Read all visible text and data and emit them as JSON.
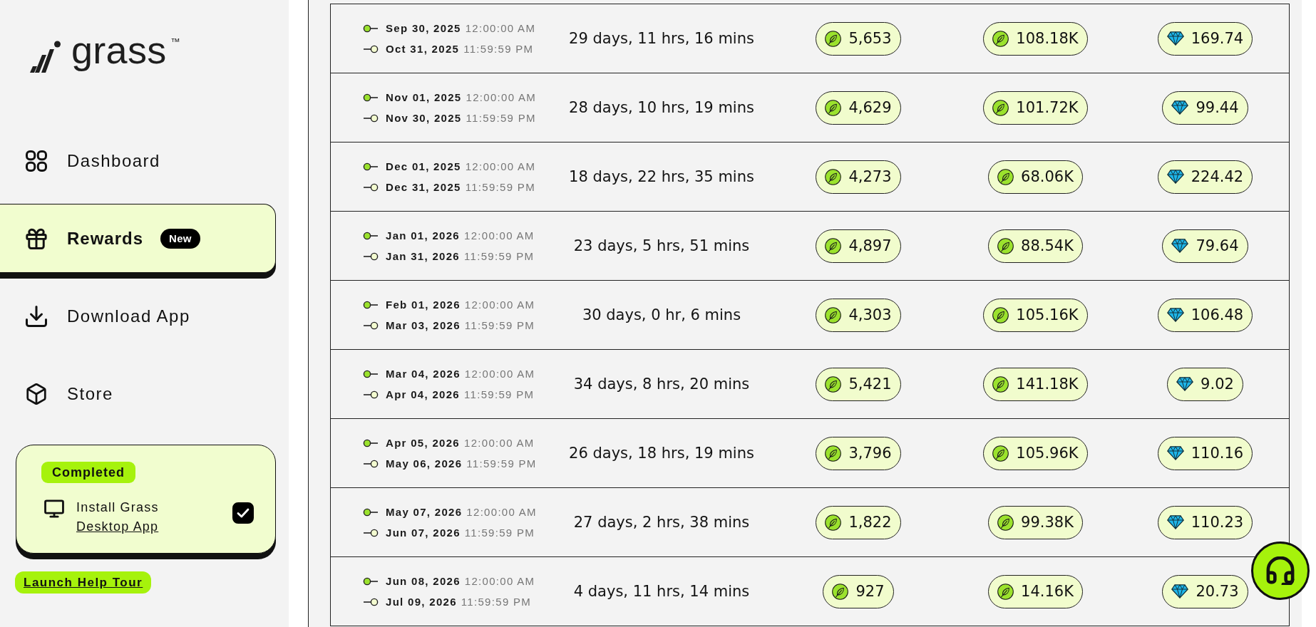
{
  "sidebar": {
    "logo": {
      "name": "grass",
      "trademark": "™"
    },
    "nav_items": [
      {
        "label": "Dashboard",
        "selected": false
      },
      {
        "label": "Rewards",
        "selected": true,
        "badge": "New"
      },
      {
        "label": "Download App",
        "selected": false
      },
      {
        "label": "Store",
        "selected": false
      }
    ],
    "task_card": {
      "status": "Completed",
      "text": "Install Grass",
      "link": "Desktop App",
      "checked": true
    },
    "help_tour": "Launch Help Tour"
  },
  "table": {
    "rows": [
      {
        "column_1": {
          "start": {
            "date": "Sep 30, 2025",
            "time": "12:00:00 AM"
          },
          "end": {
            "date": "Oct 31, 2025",
            "time": "11:59:59 PM"
          }
        },
        "column_2": "29 days, 11 hrs, 16 mins",
        "column_3": "5,653",
        "column_4": "108.18K",
        "column_5": "169.74"
      },
      {
        "column_1": {
          "start": {
            "date": "Nov 01, 2025",
            "time": "12:00:00 AM"
          },
          "end": {
            "date": "Nov 30, 2025",
            "time": "11:59:59 PM"
          }
        },
        "column_2": "28 days, 10 hrs, 19 mins",
        "column_3": "4,629",
        "column_4": "101.72K",
        "column_5": "99.44"
      },
      {
        "column_1": {
          "start": {
            "date": "Dec 01, 2025",
            "time": "12:00:00 AM"
          },
          "end": {
            "date": "Dec 31, 2025",
            "time": "11:59:59 PM"
          }
        },
        "column_2": "18 days, 22 hrs, 35 mins",
        "column_3": "4,273",
        "column_4": "68.06K",
        "column_5": "224.42"
      },
      {
        "column_1": {
          "start": {
            "date": "Jan 01, 2026",
            "time": "12:00:00 AM"
          },
          "end": {
            "date": "Jan 31, 2026",
            "time": "11:59:59 PM"
          }
        },
        "column_2": "23 days, 5 hrs, 51 mins",
        "column_3": "4,897",
        "column_4": "88.54K",
        "column_5": "79.64"
      },
      {
        "column_1": {
          "start": {
            "date": "Feb 01, 2026",
            "time": "12:00:00 AM"
          },
          "end": {
            "date": "Mar 03, 2026",
            "time": "11:59:59 PM"
          }
        },
        "column_2": "30 days, 0 hr, 6 mins",
        "column_3": "4,303",
        "column_4": "105.16K",
        "column_5": "106.48"
      },
      {
        "column_1": {
          "start": {
            "date": "Mar 04, 2026",
            "time": "12:00:00 AM"
          },
          "end": {
            "date": "Apr 04, 2026",
            "time": "11:59:59 PM"
          }
        },
        "column_2": "34 days, 8 hrs, 20 mins",
        "column_3": "5,421",
        "column_4": "141.18K",
        "column_5": "9.02"
      },
      {
        "column_1": {
          "start": {
            "date": "Apr 05, 2026",
            "time": "12:00:00 AM"
          },
          "end": {
            "date": "May 06, 2026",
            "time": "11:59:59 PM"
          }
        },
        "column_2": "26 days, 18 hrs, 19 mins",
        "column_3": "3,796",
        "column_4": "105.96K",
        "column_5": "110.16"
      },
      {
        "column_1": {
          "start": {
            "date": "May 07, 2026",
            "time": "12:00:00 AM"
          },
          "end": {
            "date": "Jun 07, 2026",
            "time": "11:59:59 PM"
          }
        },
        "column_2": "27 days, 2 hrs, 38 mins",
        "column_3": "1,822",
        "column_4": "99.38K",
        "column_5": "110.23"
      },
      {
        "column_1": {
          "start": {
            "date": "Jun 08, 2026",
            "time": "12:00:00 AM"
          },
          "end": {
            "date": "Jul 09, 2026",
            "time": "11:59:59 PM"
          }
        },
        "column_2": "4 days, 11 hrs, 14 mins",
        "column_3": "927",
        "column_4": "14.16K",
        "column_5": "20.73"
      }
    ]
  }
}
